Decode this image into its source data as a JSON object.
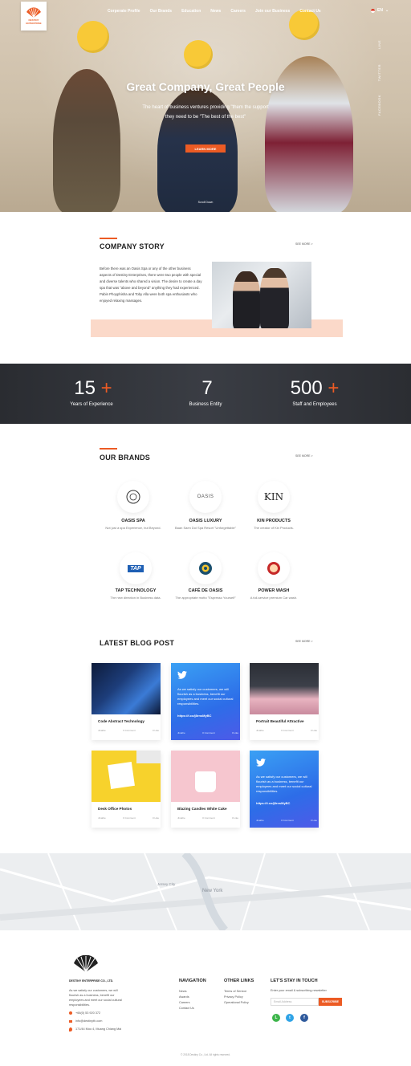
{
  "header": {
    "logo_text": [
      "DESTINY",
      "ENTERPRISE"
    ],
    "nav": [
      "Corperate Profile",
      "Our Brands",
      "Education",
      "News",
      "Careers",
      "Join our Business",
      "Contact Us"
    ],
    "lang": "EN"
  },
  "hero": {
    "title": "Great Company, Great People",
    "subtitle": "The heart of business ventures providing \"them the support they need to be \"The best of the best\"",
    "button": "LEARN MORE",
    "scroll": "Scroll Down",
    "social": [
      "LINE",
      "TWITTER",
      "FACEBOOK"
    ]
  },
  "story": {
    "title": "COMPANY STORY",
    "see_more": "SEE MORE >",
    "text": "Before there was an Oasis Spa or any of the other business aspects of Destiny Enterprises, there were two people with special and diverse talents who shared a vision. The desire to create a day spa that was \"above and beyond\" anything they had experienced. Pabin Phoyphisha and Toby Alla were both spa enthusiasts who enjoyed relaxing massages."
  },
  "stats": [
    {
      "number": "15",
      "plus": "+",
      "label": "Years of Experience"
    },
    {
      "number": "7",
      "plus": "",
      "label": "Business Entity"
    },
    {
      "number": "500",
      "plus": "+",
      "label": "Staff and Employees"
    }
  ],
  "brands": {
    "title": "OUR BRANDS",
    "see_more": "SEE MORE >",
    "items": [
      {
        "name": "OASIS SPA",
        "desc": "Not just a spa Experience, but Beyond."
      },
      {
        "name": "OASIS LUXURY",
        "desc": "Baan Saen Doi Spa Resort \"Unforgettable\""
      },
      {
        "name": "KIN PRODUCTS",
        "desc": "The creator of Kin Products."
      },
      {
        "name": "TAP TECHNOLOGY",
        "desc": "The new direction in Business data."
      },
      {
        "name": "CAFÉ DE OASIS",
        "desc": "The appropriate motto \"Espresso Yourself\""
      },
      {
        "name": "POWER WASH",
        "desc": "A full-service premium Car wash."
      }
    ],
    "logo_labels": {
      "oasis": "OASIS",
      "kin": "KIN",
      "tap": "TAP"
    }
  },
  "blog": {
    "title": "LATEST BLOG POST",
    "see_more": "SEE MORE >",
    "tweet_text": "As we satisfy our customers, we will flourish as a business, benefit our employees and meet our social cultural responsibilities.",
    "tweet_link": "https://t.co/j8rnsMyBC",
    "meta": [
      "Jinathe",
      "0 Comment",
      "0 Like"
    ],
    "posts": [
      {
        "title": "Code Abstract Technology"
      },
      {
        "title": "Portrait Beautiful Attractive"
      },
      {
        "title": "Desk Office Photos"
      },
      {
        "title": "Blazing Candles White Cake"
      }
    ]
  },
  "map": {
    "labels": [
      "Jersey City",
      "New York"
    ]
  },
  "footer": {
    "company": "DESTINY ENTERPRISE CO., LTD.",
    "about": "As we satisfy our customers, we will flourish as a business, benefit our employees and meet our social cultural responsibilities.",
    "phone": "+66(0) 53 920 372",
    "email": "info@destinyth.com",
    "address": "171/44 Moo 4, Muang Chiang Mai",
    "nav_head": "NAVIGATION",
    "nav_links": [
      "News",
      "Awards",
      "Careers",
      "Contact Us"
    ],
    "other_head": "OTHER LINKS",
    "other_links": [
      "Terms of Service",
      "Privacy Policy",
      "Operational Policy"
    ],
    "touch_head": "LET'S STAY IN TOUCH",
    "touch_text": "Enter your email & subscribing newsletter",
    "email_placeholder": "Email Address",
    "subscribe": "SUBSCRIBE",
    "copyright": "© 2018 Destiny Co., Ltd. All rights reserved."
  },
  "colors": {
    "accent": "#ec5b24",
    "dark": "#2b2d32",
    "pink": "#fbd9c9",
    "twitter": "#3a8ef0"
  }
}
